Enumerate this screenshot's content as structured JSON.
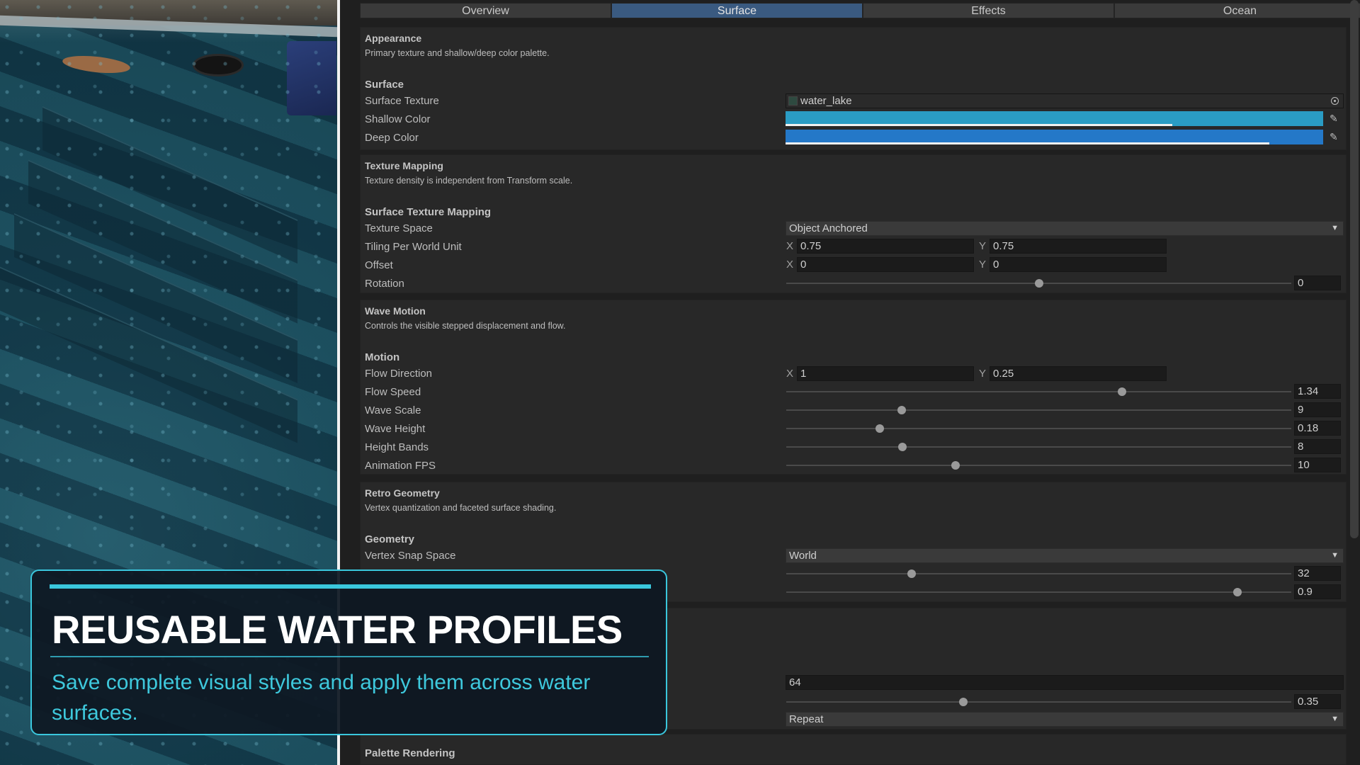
{
  "tabs": [
    {
      "label": "Overview",
      "active": false
    },
    {
      "label": "Surface",
      "active": true
    },
    {
      "label": "Effects",
      "active": false
    },
    {
      "label": "Ocean",
      "active": false
    }
  ],
  "appearance": {
    "title": "Appearance",
    "description": "Primary texture and shallow/deep color palette.",
    "group": "Surface",
    "surface_texture": {
      "label": "Surface Texture",
      "value": "water_lake",
      "icon": "object-picker-icon"
    },
    "shallow_color": {
      "label": "Shallow Color",
      "color": "#2a9cc4",
      "alpha": 0.72,
      "icon": "eyedropper-icon"
    },
    "deep_color": {
      "label": "Deep Color",
      "color": "#2478c8",
      "alpha": 0.9,
      "icon": "eyedropper-icon"
    }
  },
  "texture_mapping": {
    "title": "Texture Mapping",
    "description": "Texture density is independent from Transform scale.",
    "group": "Surface Texture Mapping",
    "texture_space": {
      "label": "Texture Space",
      "value": "Object Anchored"
    },
    "tiling": {
      "label": "Tiling Per World Unit",
      "x": "0.75",
      "y": "0.75"
    },
    "offset": {
      "label": "Offset",
      "x": "0",
      "y": "0"
    },
    "rotation": {
      "label": "Rotation",
      "value": "0",
      "fraction": 0.5
    }
  },
  "wave_motion": {
    "title": "Wave Motion",
    "description": "Controls the visible stepped displacement and flow.",
    "group": "Motion",
    "flow_direction": {
      "label": "Flow Direction",
      "x": "1",
      "y": "0.25"
    },
    "flow_speed": {
      "label": "Flow Speed",
      "value": "1.34",
      "fraction": 0.665
    },
    "wave_scale": {
      "label": "Wave Scale",
      "value": "9",
      "fraction": 0.228
    },
    "wave_height": {
      "label": "Wave Height",
      "value": "0.18",
      "fraction": 0.185
    },
    "height_bands": {
      "label": "Height Bands",
      "value": "8",
      "fraction": 0.23
    },
    "animation_fps": {
      "label": "Animation FPS",
      "value": "10",
      "fraction": 0.335
    }
  },
  "retro_geometry": {
    "title": "Retro Geometry",
    "description": "Vertex quantization and faceted surface shading.",
    "group": "Geometry",
    "vertex_snap_space": {
      "label": "Vertex Snap Space",
      "value": "World"
    },
    "snap_resolution": {
      "value": "32",
      "fraction": 0.248
    },
    "faceted_normal": {
      "value": "0.9",
      "fraction": 0.893
    }
  },
  "texture_rendering": {
    "resolution": {
      "value": "64"
    },
    "warp": {
      "value": "0.35",
      "fraction": 0.35
    },
    "wrap": {
      "value": "Repeat"
    }
  },
  "palette_rendering": {
    "title": "Palette Rendering"
  },
  "promo": {
    "title": "REUSABLE WATER PROFILES",
    "subtitle": "Save complete visual styles and apply them across water surfaces.",
    "accent_color": "#3ac7dd"
  },
  "icons": {
    "dropdown_arrow": "▼",
    "eyedropper": "✎"
  }
}
